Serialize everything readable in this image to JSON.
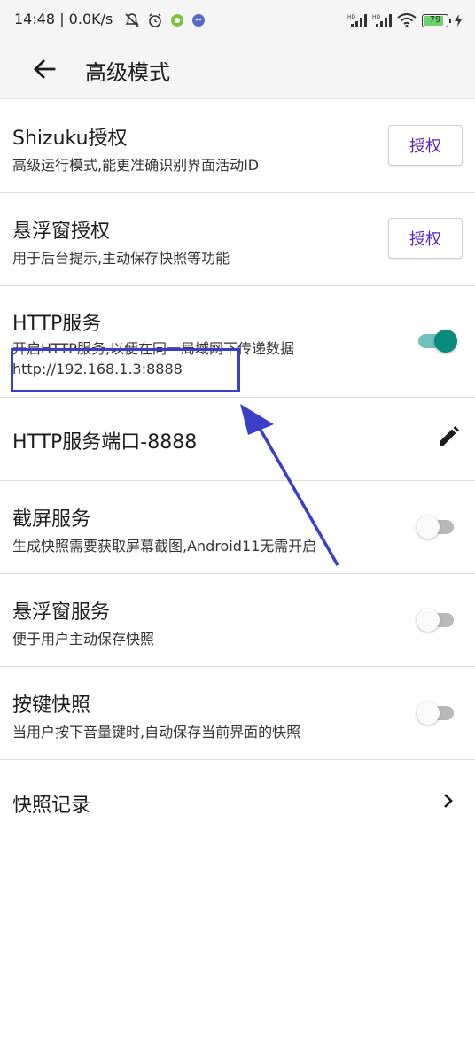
{
  "status_bar": {
    "time_speed": "14:48 | 0.0K/s",
    "battery": "79",
    "signal_1": "HD",
    "signal_2": "HD"
  },
  "app_bar": {
    "title": "高级模式",
    "back_icon": "arrow-left-icon"
  },
  "rows": [
    {
      "title": "Shizuku授权",
      "subtitle": "高级运行模式,能更准确识别界面活动ID",
      "action": "授权"
    },
    {
      "title": "悬浮窗授权",
      "subtitle": "用于后台提示,主动保存快照等功能",
      "action": "授权"
    },
    {
      "title": "HTTP服务",
      "subtitle": "开启HTTP服务,以便在同一局域网下传递数据",
      "link": "http://192.168.1.3:8888",
      "toggle": true
    },
    {
      "title": "HTTP服务端口-8888",
      "icon": "pencil-icon"
    },
    {
      "title": "截屏服务",
      "subtitle": "生成快照需要获取屏幕截图,Android11无需开启",
      "toggle": false
    },
    {
      "title": "悬浮窗服务",
      "subtitle": "便于用户主动保存快照",
      "toggle": false
    },
    {
      "title": "按键快照",
      "subtitle": "当用户按下音量键时,自动保存当前界面的快照",
      "toggle": false
    },
    {
      "title": "快照记录",
      "icon": "chevron-right-icon"
    }
  ],
  "colors": {
    "accent_button_text": "#5a1fc4",
    "switch_on": "#0a8a7d",
    "annotation": "#3a3fc8"
  }
}
